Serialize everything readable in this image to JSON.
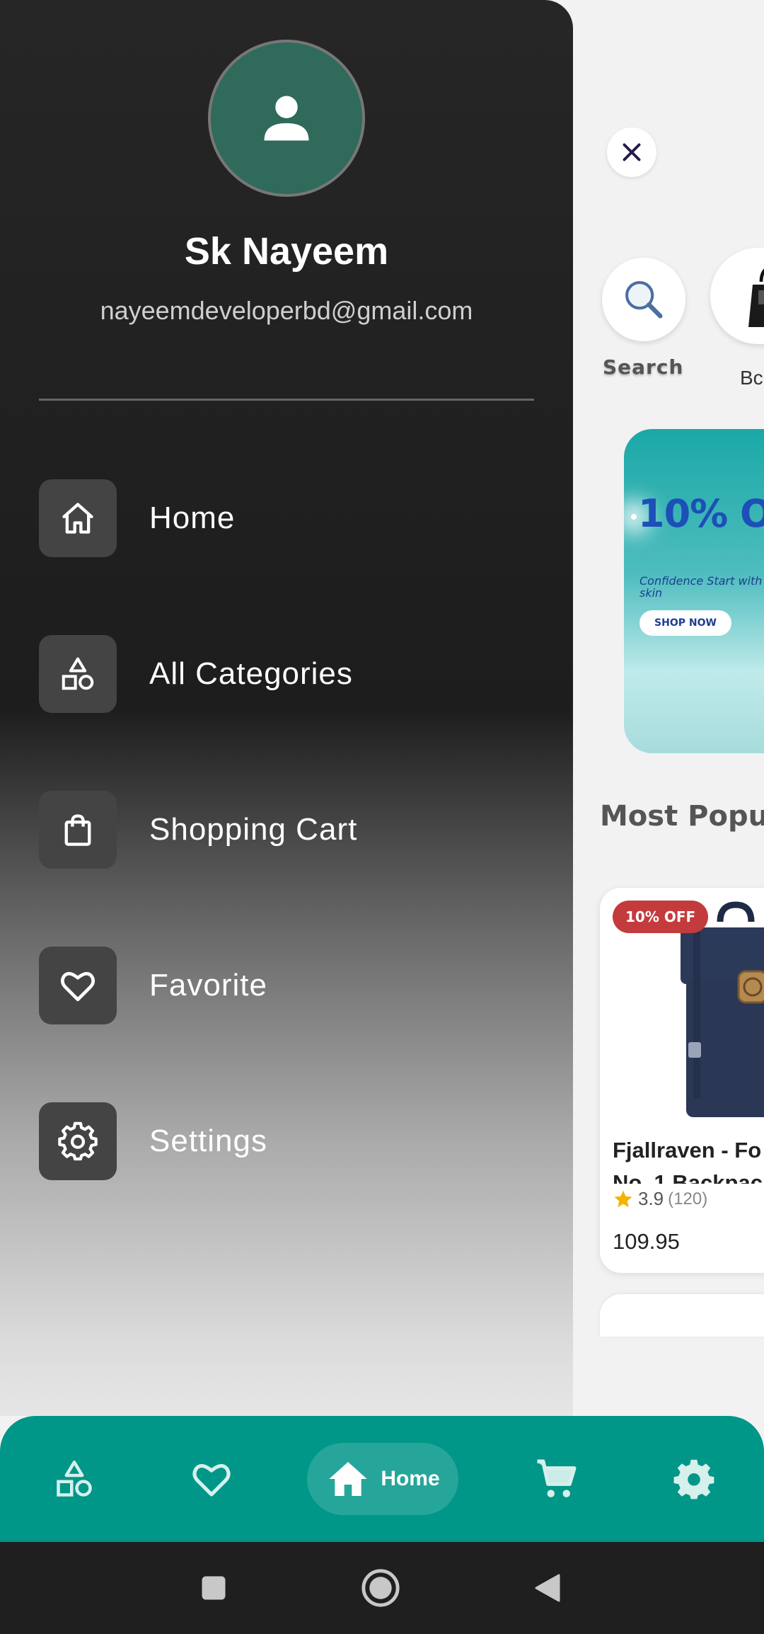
{
  "drawer": {
    "profile": {
      "name": "Sk Nayeem",
      "email": "nayeemdeveloperbd@gmail.com"
    },
    "menu": [
      {
        "label": "Home",
        "icon": "home-icon"
      },
      {
        "label": "All Categories",
        "icon": "categories-icon"
      },
      {
        "label": "Shopping Cart",
        "icon": "shopping-bag-icon"
      },
      {
        "label": "Favorite",
        "icon": "heart-icon"
      },
      {
        "label": "Settings",
        "icon": "gear-icon"
      }
    ]
  },
  "page": {
    "categories": [
      {
        "label": "Search",
        "icon": "search-icon"
      },
      {
        "label": "Bc",
        "icon": "bag-thumbnail"
      }
    ],
    "banner": {
      "title": "10% O",
      "subtitle": "Confidence Start with great skin",
      "button": "SHOP NOW"
    },
    "section_title": "Most Popu",
    "product": {
      "badge": "10% OFF",
      "name": "Fjallraven - Fo",
      "name_line2": "No. 1 Backpac",
      "rating": "3.9",
      "rating_count": "(120)",
      "price": "109.95"
    }
  },
  "bottom_nav": {
    "items": [
      {
        "icon": "categories-icon"
      },
      {
        "icon": "heart-icon"
      },
      {
        "icon": "home-icon",
        "label": "Home",
        "active": true
      },
      {
        "icon": "cart-icon"
      },
      {
        "icon": "gear-icon"
      }
    ]
  },
  "colors": {
    "accent": "#009688",
    "accent_active": "#26a69a",
    "avatar_bg": "#2f6a5b",
    "badge": "#c43b3d",
    "star": "#f5b301"
  }
}
